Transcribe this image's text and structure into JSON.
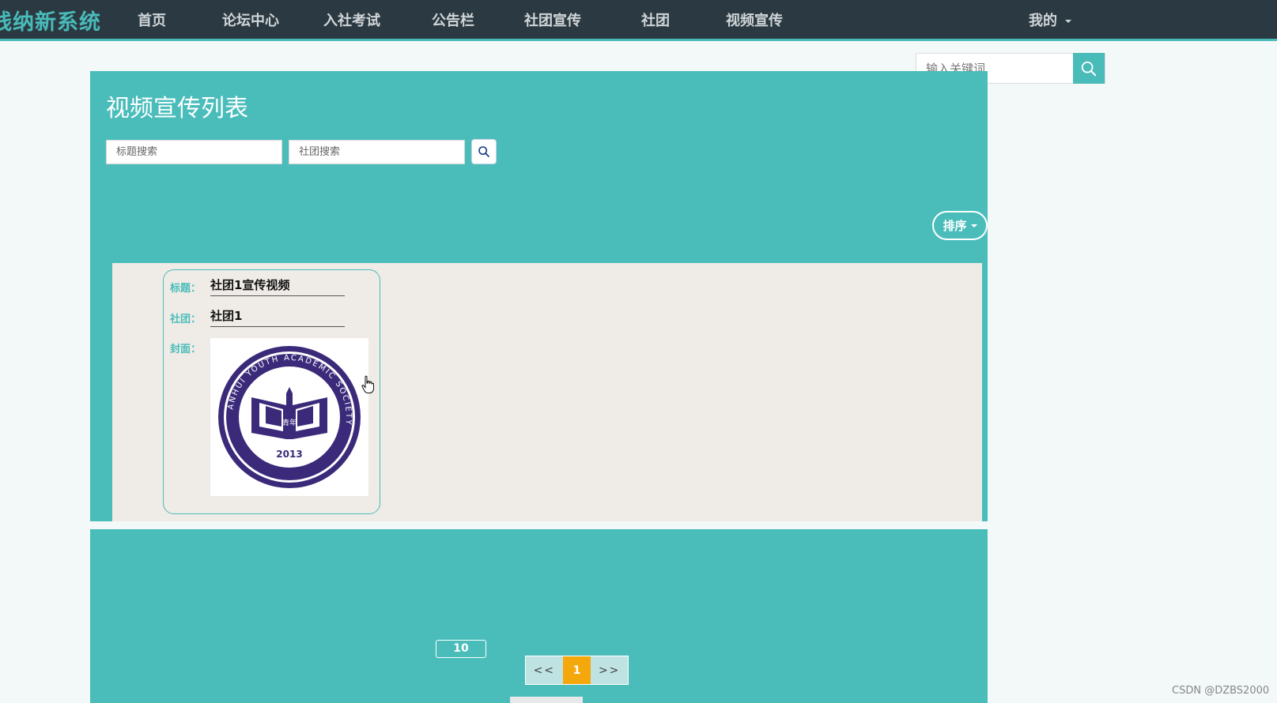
{
  "brand": "线纳新系统",
  "nav": {
    "items": [
      {
        "label": "首页"
      },
      {
        "label": "论坛中心"
      },
      {
        "label": "入社考试"
      },
      {
        "label": "公告栏"
      },
      {
        "label": "社团宣传"
      },
      {
        "label": "社团"
      },
      {
        "label": "视频宣传"
      }
    ],
    "user_menu": "我的"
  },
  "top_search": {
    "placeholder": "输入关键词",
    "icon": "search-icon"
  },
  "page_title": "视频宣传列表",
  "filters": {
    "title_placeholder": "标题搜索",
    "club_placeholder": "社团搜索",
    "search_icon": "search-icon"
  },
  "sort_button": "排序",
  "list": {
    "items": [
      {
        "title_label": "标题：",
        "title": "社团1宣传视频",
        "club_label": "社团：",
        "club": "社团1",
        "cover_label": "封面：",
        "cover_badge": {
          "year": "2013",
          "ring_text": "ANHUI YOUTH ACADEMIC SOCIETY",
          "center": "青年"
        }
      }
    ]
  },
  "pagination": {
    "page_size": "10",
    "prev": "<<",
    "current": "1",
    "next": ">>"
  },
  "watermark": "CSDN @DZBS2000",
  "colors": {
    "accent": "#4abdbb",
    "topbar": "#2b3a42",
    "current_page": "#f5a80b",
    "card_bg": "#efebe6",
    "badge": "#3b2a7a"
  }
}
